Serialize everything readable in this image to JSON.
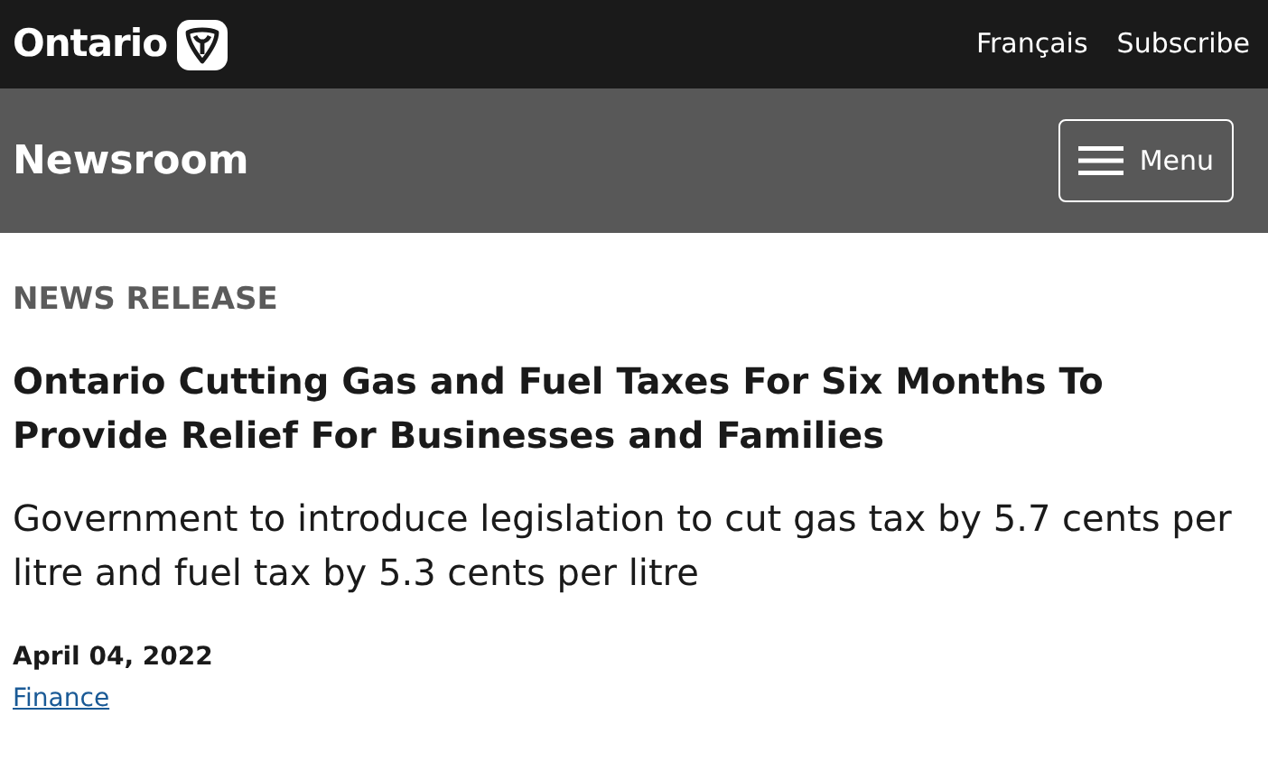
{
  "header": {
    "logo_text": "Ontario",
    "links": [
      "Français",
      "Subscribe"
    ]
  },
  "section_bar": {
    "title": "Newsroom",
    "menu_button": "Menu"
  },
  "article": {
    "label": "NEWS RELEASE",
    "headline": "Ontario Cutting Gas and Fuel Taxes For Six Months To Provide Relief For Businesses and Families",
    "subheading": "Government to introduce legislation to cut gas tax by 5.7 cents per litre and fuel tax by 5.3 cents per litre",
    "date": "April 04, 2022",
    "category_link": "Finance"
  }
}
